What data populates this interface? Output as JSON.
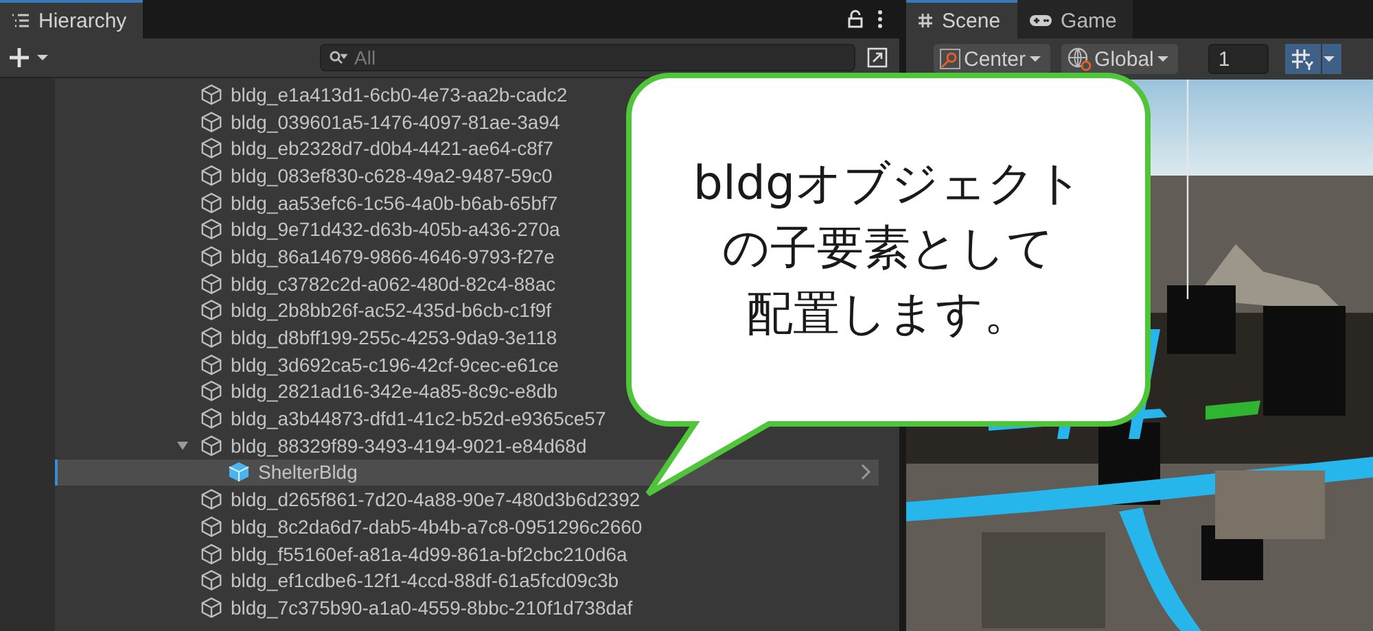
{
  "hierarchy": {
    "title": "Hierarchy",
    "search": {
      "placeholder": "All"
    },
    "items": [
      {
        "name": "bldg_e1a413d1-6cb0-4e73-aa2b-cadc2",
        "kind": "object",
        "selected": false
      },
      {
        "name": "bldg_039601a5-1476-4097-81ae-3a94",
        "kind": "object",
        "selected": false
      },
      {
        "name": "bldg_eb2328d7-d0b4-4421-ae64-c8f7",
        "kind": "object",
        "selected": false
      },
      {
        "name": "bldg_083ef830-c628-49a2-9487-59c0",
        "kind": "object",
        "selected": false
      },
      {
        "name": "bldg_aa53efc6-1c56-4a0b-b6ab-65bf7",
        "kind": "object",
        "selected": false
      },
      {
        "name": "bldg_9e71d432-d63b-405b-a436-270a",
        "kind": "object",
        "selected": false
      },
      {
        "name": "bldg_86a14679-9866-4646-9793-f27e",
        "kind": "object",
        "selected": false
      },
      {
        "name": "bldg_c3782c2d-a062-480d-82c4-88ac",
        "kind": "object",
        "selected": false
      },
      {
        "name": "bldg_2b8bb26f-ac52-435d-b6cb-c1f9f",
        "kind": "object",
        "selected": false
      },
      {
        "name": "bldg_d8bff199-255c-4253-9da9-3e118",
        "kind": "object",
        "selected": false
      },
      {
        "name": "bldg_3d692ca5-c196-42cf-9cec-e61ce",
        "kind": "object",
        "selected": false
      },
      {
        "name": "bldg_2821ad16-342e-4a85-8c9c-e8db",
        "kind": "object",
        "selected": false
      },
      {
        "name": "bldg_a3b44873-dfd1-41c2-b52d-e9365ce57",
        "kind": "object",
        "selected": false
      },
      {
        "name": "bldg_88329f89-3493-4194-9021-e84d68d",
        "kind": "object",
        "selected": false,
        "expanded": true,
        "children": [
          {
            "name": "ShelterBldg",
            "kind": "prefab",
            "selected": true
          }
        ]
      },
      {
        "name": "bldg_d265f861-7d20-4a88-90e7-480d3b6d2392",
        "kind": "object",
        "selected": false
      },
      {
        "name": "bldg_8c2da6d7-dab5-4b4b-a7c8-0951296c2660",
        "kind": "object",
        "selected": false
      },
      {
        "name": "bldg_f55160ef-a81a-4d99-861a-bf2cbc210d6a",
        "kind": "object",
        "selected": false
      },
      {
        "name": "bldg_ef1cdbe6-12f1-4ccd-88df-61a5fcd09c3b",
        "kind": "object",
        "selected": false
      },
      {
        "name": "bldg_7c375b90-a1a0-4559-8bbc-210f1d738daf",
        "kind": "object",
        "selected": false
      }
    ]
  },
  "scene": {
    "tabs": [
      {
        "label": "Scene",
        "kind": "scene",
        "selected": true
      },
      {
        "label": "Game",
        "kind": "game",
        "selected": false
      }
    ],
    "pivot": "Center",
    "space": "Global",
    "snap_value": "1"
  },
  "callout": [
    "bldgオブジェクト",
    "の子要素として",
    "配置します。"
  ]
}
